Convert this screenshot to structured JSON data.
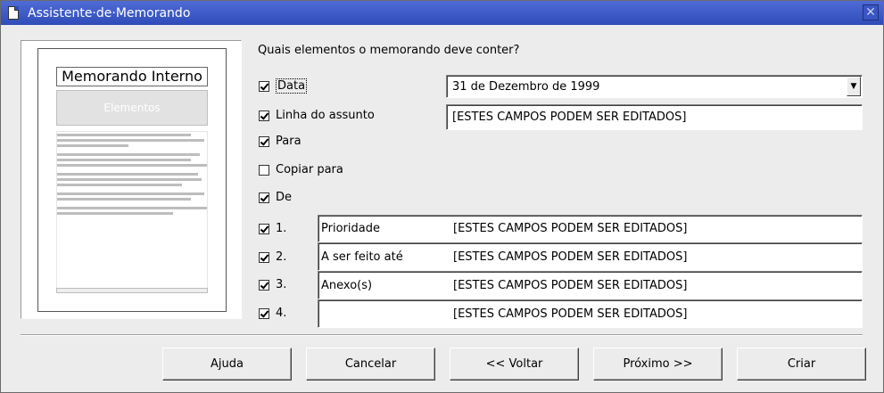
{
  "window": {
    "title": "Assistente·de·Memorando",
    "close_glyph": "✕"
  },
  "preview": {
    "title": "Memorando Interno",
    "elements_label": "Elementos"
  },
  "question": "Quais elementos o memorando deve conter?",
  "options": {
    "data": {
      "label": "Data",
      "checked": true,
      "value": "31 de Dezembro de 1999"
    },
    "subject": {
      "label": "Linha do assunto",
      "checked": true,
      "value": "[ESTES CAMPOS PODEM SER EDITADOS]"
    },
    "to": {
      "label": "Para",
      "checked": true
    },
    "copy_to": {
      "label": "Copiar para",
      "checked": false
    },
    "from": {
      "label": "De",
      "checked": true
    }
  },
  "numbered": [
    {
      "num": "1.",
      "checked": true,
      "label": "Prioridade",
      "value": "[ESTES CAMPOS PODEM SER EDITADOS]"
    },
    {
      "num": "2.",
      "checked": true,
      "label": "A ser feito até",
      "value": "[ESTES CAMPOS PODEM SER EDITADOS]"
    },
    {
      "num": "3.",
      "checked": true,
      "label": "Anexo(s)",
      "value": "[ESTES CAMPOS PODEM SER EDITADOS]"
    },
    {
      "num": "4.",
      "checked": true,
      "label": "",
      "value": "[ESTES CAMPOS PODEM SER EDITADOS]"
    }
  ],
  "buttons": {
    "help": "Ajuda",
    "cancel": "Cancelar",
    "back": "<< Voltar",
    "next": "Próximo >>",
    "create": "Criar"
  }
}
